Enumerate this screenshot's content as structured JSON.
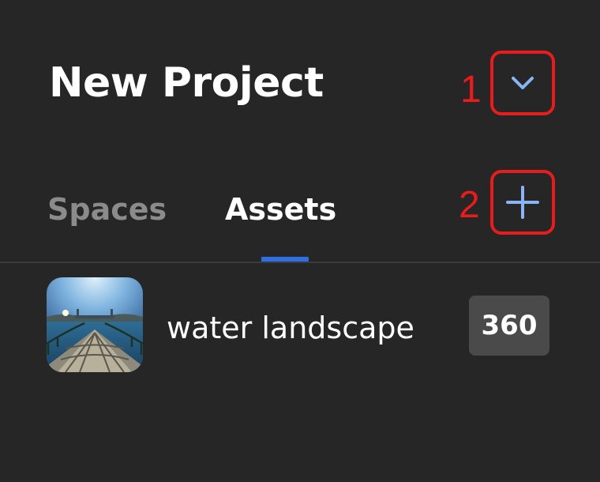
{
  "header": {
    "project_title": "New Project"
  },
  "controls": {
    "collapse_icon": "chevron-down-icon",
    "add_icon": "plus-icon",
    "icon_color": "#8ab4f8"
  },
  "annotations": {
    "one": "1",
    "two": "2",
    "color": "#e81c1c"
  },
  "tabs": [
    {
      "label": "Spaces",
      "active": false
    },
    {
      "label": "Assets",
      "active": true
    }
  ],
  "accent_color": "#2f6fe6",
  "assets": [
    {
      "name": "water landscape",
      "badge": "360"
    }
  ]
}
